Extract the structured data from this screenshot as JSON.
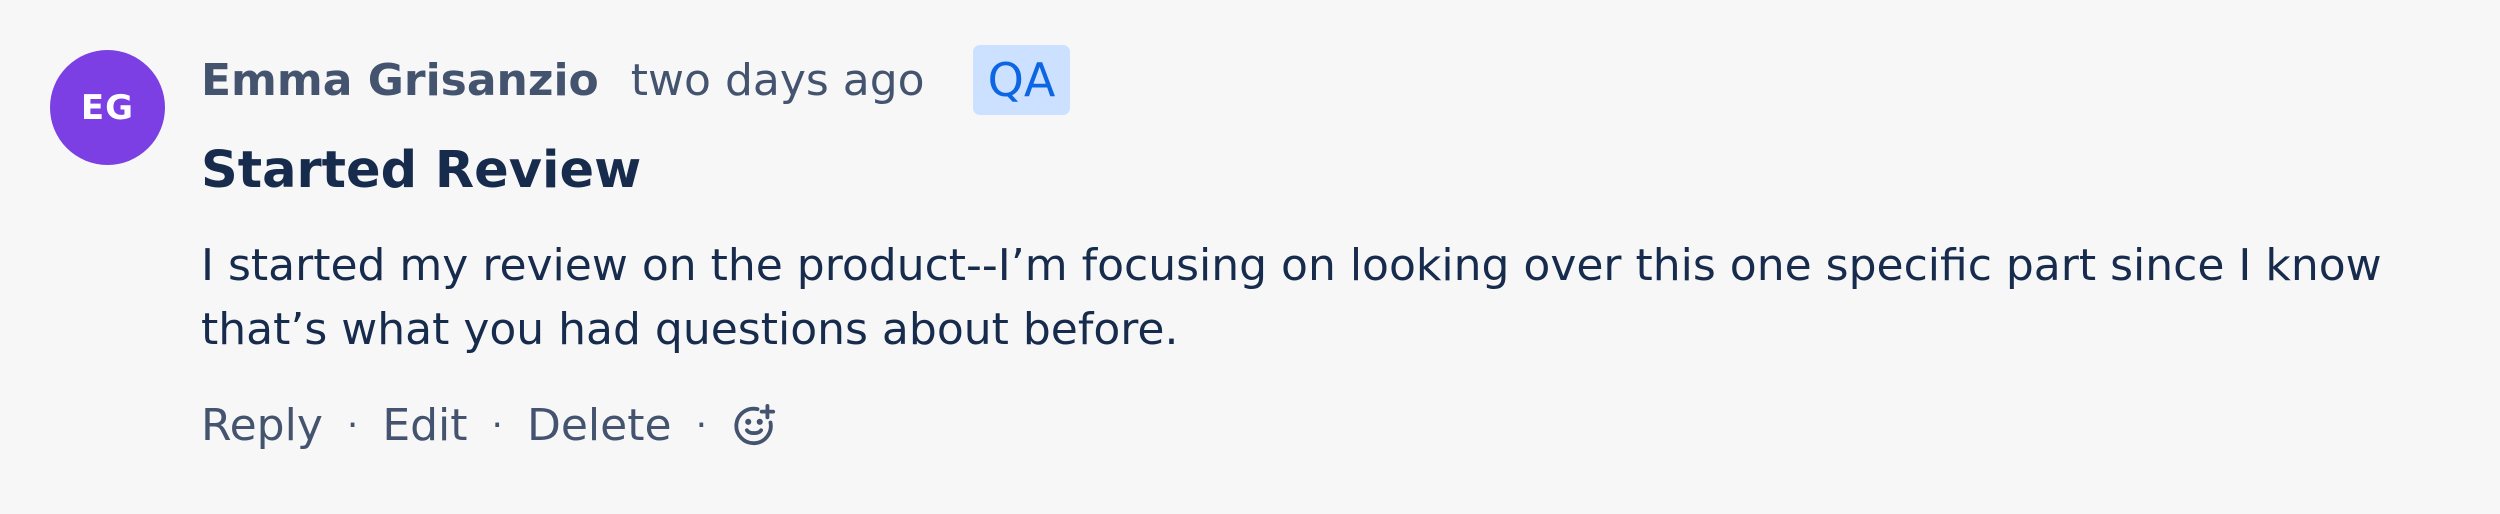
{
  "comment": {
    "avatar_initials": "EG",
    "author": "Emma Grisanzio",
    "time": "two days ago",
    "badge": "QA",
    "title": "Started Review",
    "body": "I started my review on the product--I’m focusing on looking over this one specific part since I know that’s what you had questions about before.",
    "actions": {
      "reply": "Reply",
      "edit": "Edit",
      "delete": "Delete",
      "separator": "·",
      "emoji_icon": "add-reaction-icon"
    }
  },
  "colors": {
    "avatar_bg": "#7b3fe4",
    "badge_bg": "#cce0ff",
    "badge_text": "#0c66e4",
    "text_primary": "#172b4d",
    "text_secondary": "#44546f",
    "page_bg": "#f7f7f8"
  }
}
